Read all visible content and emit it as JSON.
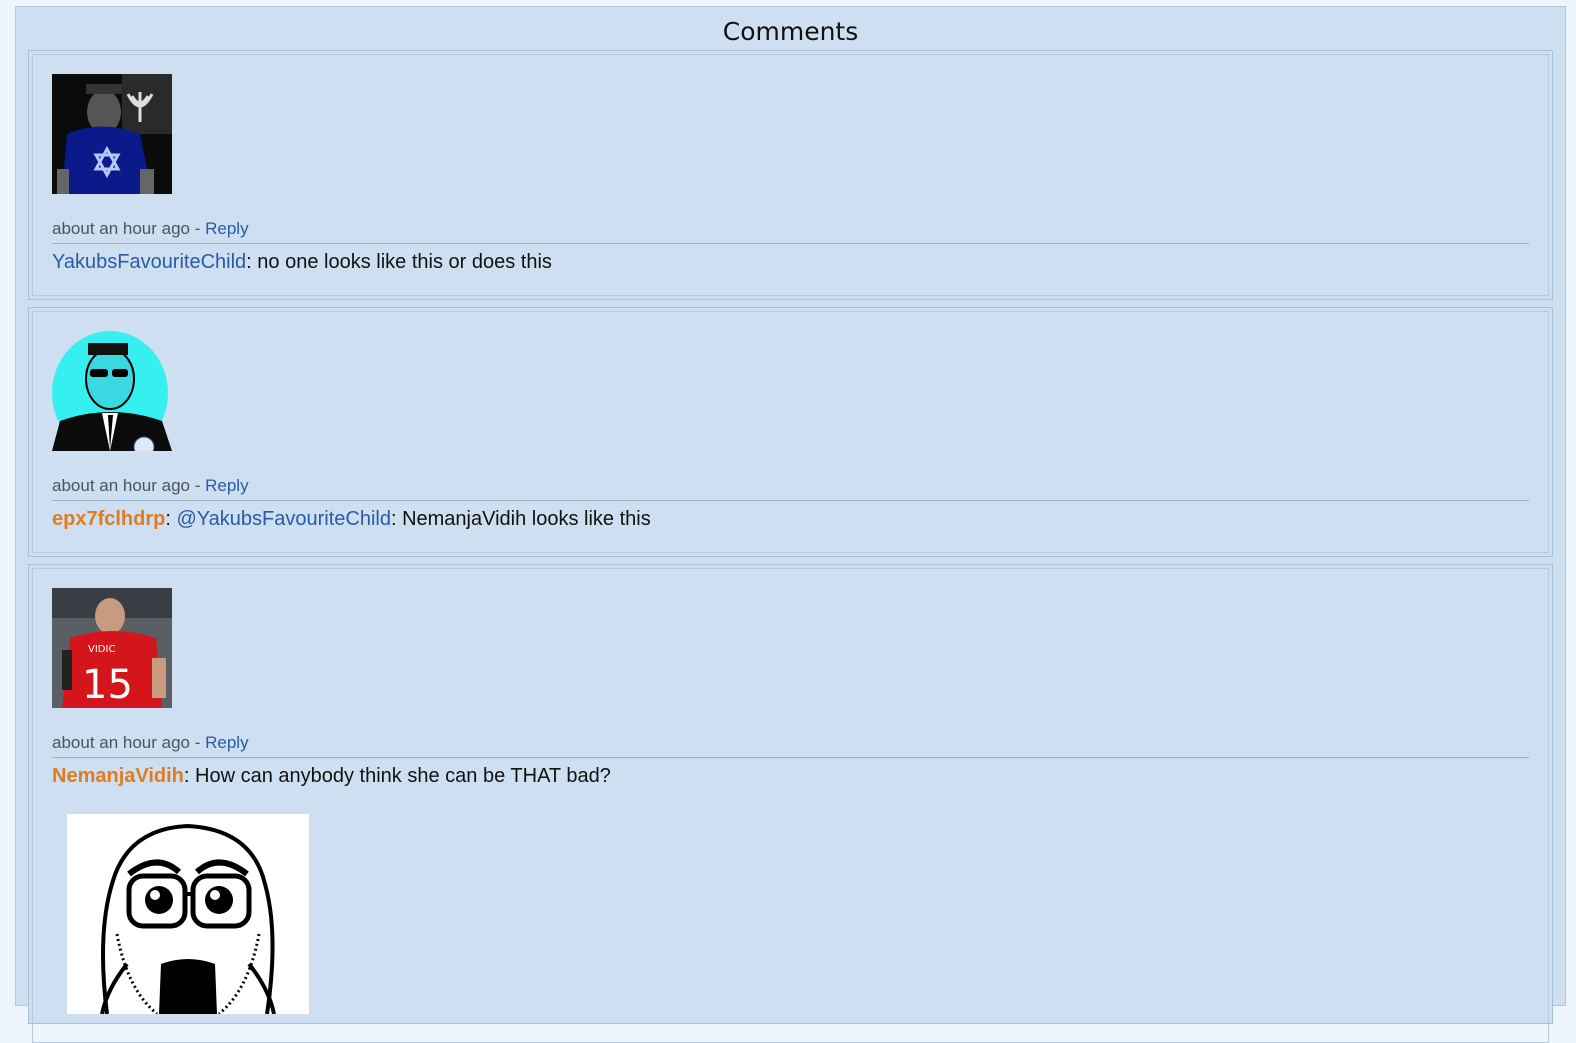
{
  "panel": {
    "title": "Comments"
  },
  "comments": [
    {
      "avatar_icon": "avatar-star-of-david-shirt",
      "time": "about an hour ago",
      "separator": " - ",
      "reply_label": "Reply",
      "username": "YakubsFavouriteChild",
      "username_style": "blue",
      "text": ": no one looks like this or does this"
    },
    {
      "avatar_icon": "avatar-cyan-suit-man",
      "time": "about an hour ago",
      "separator": " - ",
      "reply_label": "Reply",
      "username": "epx7fclhdrp",
      "username_style": "orange",
      "colon": ": ",
      "mention": "@YakubsFavouriteChild",
      "text": ": NemanjaVidih looks like this"
    },
    {
      "avatar_icon": "avatar-football-player-15",
      "time": "about an hour ago",
      "separator": " - ",
      "reply_label": "Reply",
      "username": "NemanjaVidih",
      "username_style": "orange",
      "text": ": How can anybody think she can be THAT bad?",
      "attachment_icon": "wojak-glasses-meme-image"
    }
  ],
  "colors": {
    "panel_bg": "#cddff0",
    "link_blue": "#2a5aa8",
    "user_orange": "#e07b22",
    "page_bg": "#eef4fb"
  }
}
